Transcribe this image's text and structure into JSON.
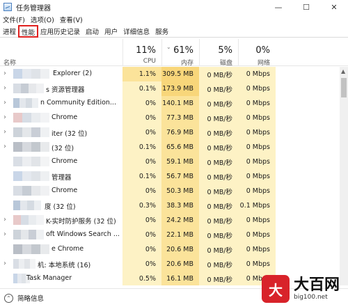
{
  "window": {
    "title": "任务管理器",
    "minimize": "—",
    "maximize": "☐",
    "close": "✕"
  },
  "menu": [
    "文件(F)",
    "选项(O)",
    "查看(V)"
  ],
  "tabs": [
    {
      "label": "进程",
      "active": false,
      "highlight": false
    },
    {
      "label": "性能",
      "active": true,
      "highlight": true
    },
    {
      "label": "应用历史记录",
      "active": false,
      "highlight": false
    },
    {
      "label": "启动",
      "active": false,
      "highlight": false
    },
    {
      "label": "用户",
      "active": false,
      "highlight": false
    },
    {
      "label": "详细信息",
      "active": false,
      "highlight": false
    },
    {
      "label": "服务",
      "active": false,
      "highlight": false
    }
  ],
  "columns": {
    "name": "名称",
    "cpu": {
      "percent": "11%",
      "label": "CPU"
    },
    "memory": {
      "percent": "61%",
      "label": "内存"
    },
    "disk": {
      "percent": "5%",
      "label": "磁盘"
    },
    "network": {
      "percent": "0%",
      "label": "网络"
    }
  },
  "processes": [
    {
      "name": "Explorer (2)",
      "cpu": "1.1%",
      "memory": "309.5 MB",
      "disk": "0 MB/秒",
      "network": "0 Mbps",
      "expandable": true,
      "hi_cpu": true,
      "hi_mem": true
    },
    {
      "name": "s 资源管理器",
      "cpu": "0.1%",
      "memory": "173.9 MB",
      "disk": "0 MB/秒",
      "network": "0 Mbps",
      "expandable": true,
      "hi_cpu": false,
      "hi_mem": true
    },
    {
      "name": "n Community Edition...",
      "cpu": "0%",
      "memory": "140.1 MB",
      "disk": "0 MB/秒",
      "network": "0 Mbps",
      "expandable": true,
      "hi_cpu": false,
      "hi_mem": false
    },
    {
      "name": "Chrome",
      "cpu": "0%",
      "memory": "77.3 MB",
      "disk": "0 MB/秒",
      "network": "0 Mbps",
      "expandable": true,
      "hi_cpu": false,
      "hi_mem": false
    },
    {
      "name": "iter (32 位)",
      "cpu": "0%",
      "memory": "76.9 MB",
      "disk": "0 MB/秒",
      "network": "0 Mbps",
      "expandable": true,
      "hi_cpu": false,
      "hi_mem": false
    },
    {
      "name": "(32 位)",
      "cpu": "0.1%",
      "memory": "65.6 MB",
      "disk": "0 MB/秒",
      "network": "0 Mbps",
      "expandable": true,
      "hi_cpu": false,
      "hi_mem": false
    },
    {
      "name": "Chrome",
      "cpu": "0%",
      "memory": "59.1 MB",
      "disk": "0 MB/秒",
      "network": "0 Mbps",
      "expandable": false,
      "hi_cpu": false,
      "hi_mem": false
    },
    {
      "name": "管理器",
      "cpu": "0.1%",
      "memory": "56.7 MB",
      "disk": "0 MB/秒",
      "network": "0 Mbps",
      "expandable": false,
      "hi_cpu": false,
      "hi_mem": false
    },
    {
      "name": "Chrome",
      "cpu": "0%",
      "memory": "50.3 MB",
      "disk": "0 MB/秒",
      "network": "0 Mbps",
      "expandable": false,
      "hi_cpu": false,
      "hi_mem": false
    },
    {
      "name": "度 (32 位)",
      "cpu": "0.3%",
      "memory": "38.3 MB",
      "disk": "0 MB/秒",
      "network": "0.1 Mbps",
      "expandable": false,
      "hi_cpu": false,
      "hi_mem": false
    },
    {
      "name": "K-实时防护服务 (32 位)",
      "cpu": "0%",
      "memory": "24.2 MB",
      "disk": "0 MB/秒",
      "network": "0 Mbps",
      "expandable": true,
      "hi_cpu": false,
      "hi_mem": false
    },
    {
      "name": "oft Windows Search ...",
      "cpu": "0%",
      "memory": "22.1 MB",
      "disk": "0 MB/秒",
      "network": "0 Mbps",
      "expandable": true,
      "hi_cpu": false,
      "hi_mem": false
    },
    {
      "name": "e Chrome",
      "cpu": "0%",
      "memory": "20.6 MB",
      "disk": "0 MB/秒",
      "network": "0 Mbps",
      "expandable": false,
      "hi_cpu": false,
      "hi_mem": false
    },
    {
      "name": "机: 本地系统 (16)",
      "cpu": "0%",
      "memory": "20.6 MB",
      "disk": "0 MB/秒",
      "network": "0 Mbps",
      "expandable": true,
      "hi_cpu": false,
      "hi_mem": false
    },
    {
      "name": "Task Manager",
      "cpu": "0.5%",
      "memory": "16.1 MB",
      "disk": "0 MB/秒",
      "network": "0 Mbps",
      "expandable": false,
      "hi_cpu": false,
      "hi_mem": false
    }
  ],
  "footer": {
    "label": "简略信息"
  },
  "watermark": {
    "logo": "大",
    "title": "大百网",
    "url": "big100.net"
  }
}
